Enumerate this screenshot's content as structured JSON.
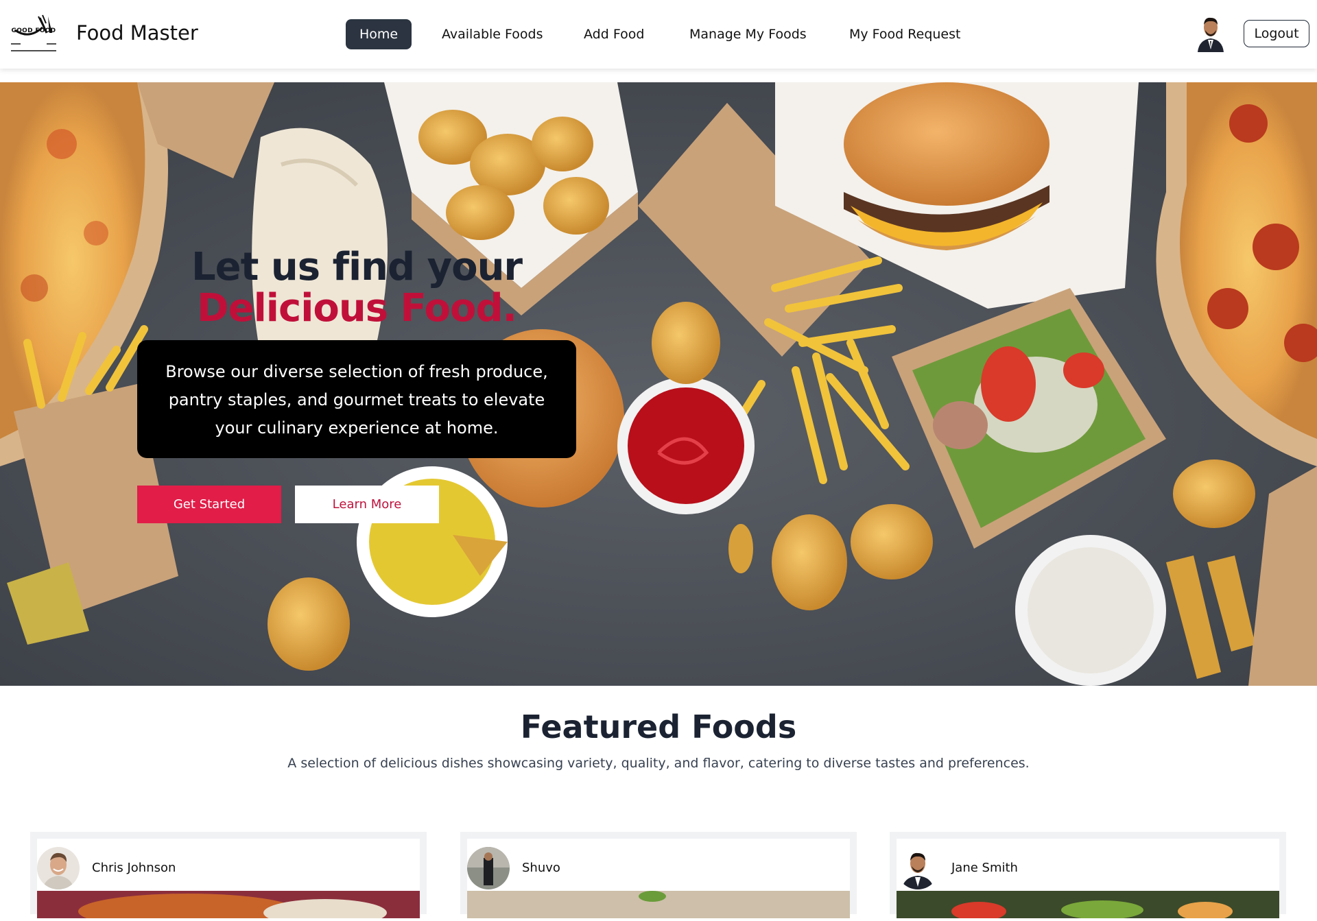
{
  "navbar": {
    "brand": "Food Master",
    "logo_text": "GOOD FOOD",
    "links": [
      {
        "label": "Home",
        "active": true
      },
      {
        "label": "Available Foods",
        "active": false
      },
      {
        "label": "Add Food",
        "active": false
      },
      {
        "label": "Manage My Foods",
        "active": false
      },
      {
        "label": "My Food Request",
        "active": false
      }
    ],
    "logout_label": "Logout"
  },
  "hero": {
    "title_line1": "Let us find your",
    "title_line2": "Delicious Food.",
    "description": "Browse our diverse selection of fresh produce, pantry staples, and gourmet treats to elevate your culinary experience at home.",
    "primary_button": "Get Started",
    "secondary_button": "Learn More"
  },
  "featured": {
    "title": "Featured Foods",
    "subtitle": "A selection of delicious dishes showcasing variety, quality, and flavor, catering to diverse tastes and preferences.",
    "cards": [
      {
        "donor_name": "Chris Johnson"
      },
      {
        "donor_name": "Shuvo"
      },
      {
        "donor_name": "Jane Smith"
      }
    ]
  },
  "colors": {
    "accent": "#e11d48",
    "accent_text": "#be123c",
    "title_dark": "#1b2332",
    "active_nav": "#2b3440"
  }
}
